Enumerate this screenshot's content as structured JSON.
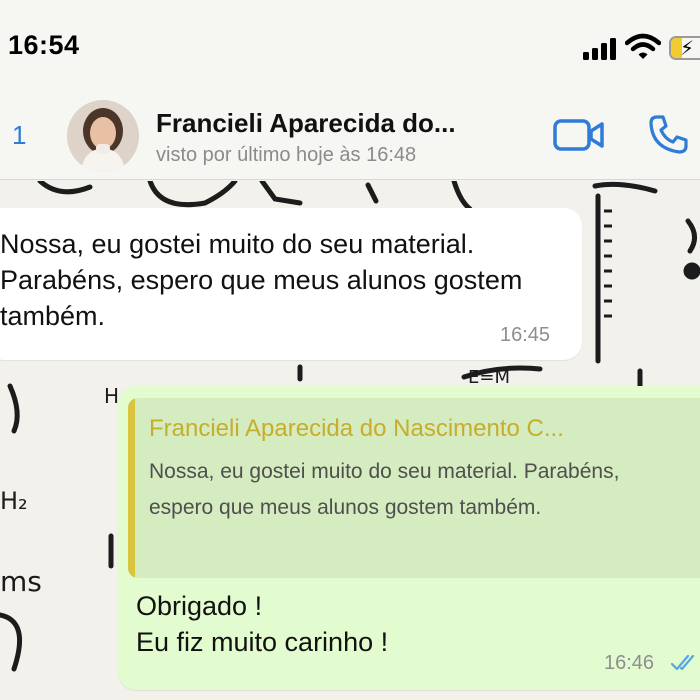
{
  "status_bar": {
    "time": "16:54"
  },
  "header": {
    "back_count": "1",
    "contact_name": "Francieli Aparecida do...",
    "last_seen": "visto por último hoje às 16:48",
    "icons": [
      "video-call-icon",
      "voice-call-icon"
    ],
    "accent_color": "#2f7bd8"
  },
  "messages": {
    "incoming": {
      "text": "Nossa, eu gostei muito do seu material.  Parabéns,  espero que meus alunos gostem também.",
      "time": "16:45"
    },
    "outgoing": {
      "quote_author": "Francieli Aparecida do Nascimento C...",
      "quote_text": "Nossa, eu gostei muito do seu material. Parabéns,  espero que meus alunos gostem também.",
      "reply_line_1": "Obrigado !",
      "reply_line_2": "Eu fiz muito carinho !",
      "time": "16:46",
      "status_icon": "double-check-read-icon"
    }
  },
  "colors": {
    "outgoing_bubble": "#e2fbcf",
    "quote_bar": "#d8c43d",
    "quote_author": "#c8ad2c",
    "read_ticks": "#53a6e8"
  },
  "wallpaper_fragments": [
    "H",
    "H₂",
    "ms",
    "E=M"
  ]
}
